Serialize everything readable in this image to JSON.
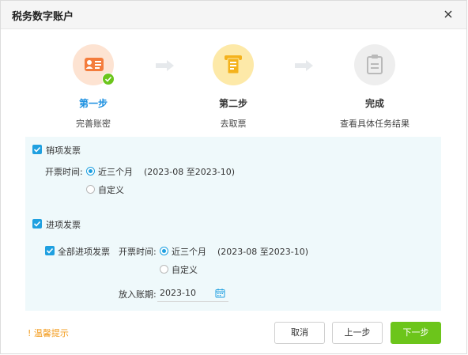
{
  "dialog": {
    "title": "税务数字账户"
  },
  "steps": [
    {
      "title": "第一步",
      "desc": "完善账密",
      "state": "done",
      "color": "#1a8fe0"
    },
    {
      "title": "第二步",
      "desc": "去取票",
      "state": "current",
      "color": "#222222"
    },
    {
      "title": "完成",
      "desc": "查看具体任务结果",
      "state": "pending",
      "color": "#222222"
    }
  ],
  "sales": {
    "label": "销项发票",
    "checked": true,
    "time_label": "开票时间:",
    "option_recent": "近三个月",
    "range": "(2023-08 至2023-10)",
    "option_custom": "自定义",
    "selected": "近三个月"
  },
  "purchase": {
    "label": "进项发票",
    "checked": true,
    "all_label": "全部进项发票",
    "all_checked": true,
    "time_label": "开票时间:",
    "option_recent": "近三个月",
    "range": "(2023-08 至2023-10)",
    "option_custom": "自定义",
    "selected": "近三个月",
    "period_label": "放入账期:",
    "period_value": "2023-10"
  },
  "footer": {
    "tip": "! 温馨提示",
    "cancel": "取消",
    "prev": "上一步",
    "next": "下一步"
  },
  "colors": {
    "accent_blue": "#1fa0e0",
    "green": "#6cc51b",
    "orange": "#f39b1b",
    "panel_bg": "#eff9fb"
  },
  "icons": {
    "close": "close-icon",
    "step1": "account-card-icon",
    "step1_badge": "check-badge-icon",
    "step2": "ticket-dispenser-icon",
    "step3": "clipboard-icon",
    "arrow": "arrow-right-icon",
    "calendar": "calendar-icon"
  }
}
